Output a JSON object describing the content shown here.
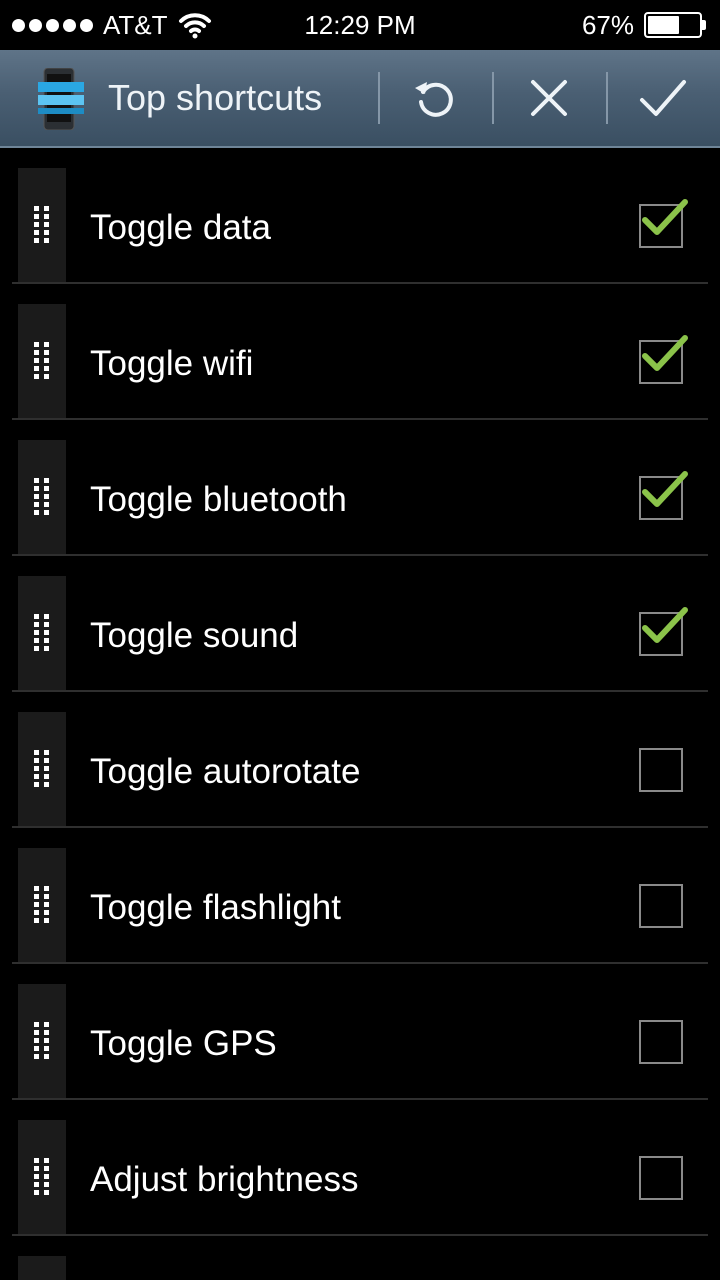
{
  "status_bar": {
    "carrier": "AT&T",
    "time": "12:29 PM",
    "battery_percent": "67%",
    "battery_level": 0.67
  },
  "action_bar": {
    "title": "Top shortcuts",
    "app_icon": "phone-app-icon",
    "buttons": [
      {
        "name": "reset-button",
        "icon": "refresh-icon"
      },
      {
        "name": "cancel-button",
        "icon": "close-icon"
      },
      {
        "name": "confirm-button",
        "icon": "checkmark-icon"
      }
    ]
  },
  "shortcuts": [
    {
      "label": "Toggle data",
      "checked": true
    },
    {
      "label": "Toggle wifi",
      "checked": true
    },
    {
      "label": "Toggle bluetooth",
      "checked": true
    },
    {
      "label": "Toggle sound",
      "checked": true
    },
    {
      "label": "Toggle autorotate",
      "checked": false
    },
    {
      "label": "Toggle flashlight",
      "checked": false
    },
    {
      "label": "Toggle GPS",
      "checked": false
    },
    {
      "label": "Adjust brightness",
      "checked": false
    }
  ],
  "colors": {
    "check_green": "#8bc34a",
    "actionbar_top": "#5f7488",
    "actionbar_bottom": "#3a4f62"
  }
}
